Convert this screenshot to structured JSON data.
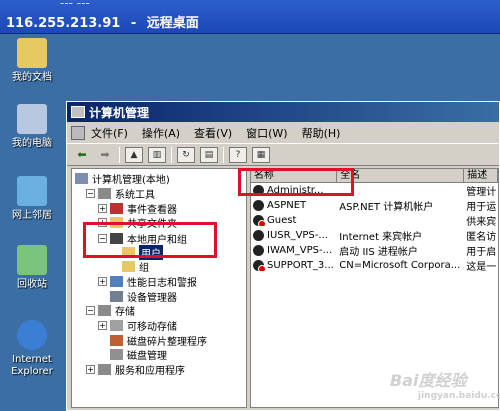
{
  "remote_desktop": {
    "title_top": "--- ---",
    "ip": "116.255.213.91",
    "separator": "-",
    "name": "远程桌面"
  },
  "desktop_icons": [
    {
      "label": "我的文档",
      "color": "#e8c860"
    },
    {
      "label": "我的电脑",
      "color": "#b8c8e0"
    },
    {
      "label": "网上邻居",
      "color": "#6ab0e0"
    },
    {
      "label": "回收站",
      "color": "#7bc47b"
    },
    {
      "label": "Internet Explorer",
      "color": "#3b7fd4"
    }
  ],
  "window": {
    "title": "计算机管理",
    "menu": [
      "文件(F)",
      "操作(A)",
      "查看(V)",
      "窗口(W)",
      "帮助(H)"
    ]
  },
  "tree": [
    {
      "label": "计算机管理(本地)",
      "pm": "",
      "icon_color": "#7a8fb0"
    },
    {
      "label": "系统工具",
      "pm": "−",
      "icon_color": "#8a8a8a"
    },
    {
      "label": "事件查看器",
      "pm": "+",
      "icon_color": "#c03030"
    },
    {
      "label": "共享文件夹",
      "pm": "+",
      "icon_color": "#e8c860"
    },
    {
      "label": "本地用户和组",
      "pm": "−",
      "icon_color": "#444444"
    },
    {
      "label": "用户",
      "pm": "",
      "icon_color": "#e8c860",
      "selected": true
    },
    {
      "label": "组",
      "pm": "",
      "icon_color": "#e8c860"
    },
    {
      "label": "性能日志和警报",
      "pm": "+",
      "icon_color": "#5080c0"
    },
    {
      "label": "设备管理器",
      "pm": "",
      "icon_color": "#708090"
    },
    {
      "label": "存储",
      "pm": "−",
      "icon_color": "#8a8a8a"
    },
    {
      "label": "可移动存储",
      "pm": "+",
      "icon_color": "#a0a0a0"
    },
    {
      "label": "磁盘碎片整理程序",
      "pm": "",
      "icon_color": "#c06030"
    },
    {
      "label": "磁盘管理",
      "pm": "",
      "icon_color": "#909090"
    },
    {
      "label": "服务和应用程序",
      "pm": "+",
      "icon_color": "#8a8a8a"
    }
  ],
  "list": {
    "columns": [
      "名称",
      "全名",
      "描述"
    ],
    "rows": [
      {
        "name": "Administr...",
        "fullname": "",
        "desc": "管理计",
        "red": false
      },
      {
        "name": "ASPNET",
        "fullname": "ASP.NET 计算机帐户",
        "desc": "用于运",
        "red": false
      },
      {
        "name": "Guest",
        "fullname": "",
        "desc": "供来宾",
        "red": true
      },
      {
        "name": "IUSR_VPS-...",
        "fullname": "Internet 来宾帐户",
        "desc": "匿名访",
        "red": false
      },
      {
        "name": "IWAM_VPS-...",
        "fullname": "启动 IIS 进程帐户",
        "desc": "用于启",
        "red": false
      },
      {
        "name": "SUPPORT_3...",
        "fullname": "CN=Microsoft Corpora...",
        "desc": "这是一",
        "red": true
      }
    ]
  },
  "watermark": {
    "main": "Bai度经验",
    "sub": "jingyan.baidu.com"
  },
  "highlight_color": "#e0102a"
}
